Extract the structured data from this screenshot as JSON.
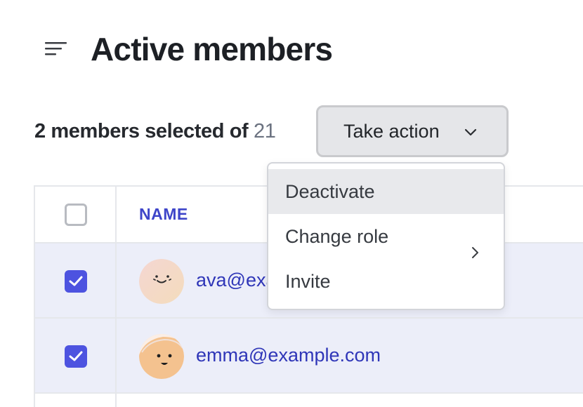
{
  "header": {
    "title": "Active members",
    "menu_icon": "menu-lines-icon"
  },
  "selection": {
    "selected_text": "2 members selected of ",
    "total": "21"
  },
  "action_button": {
    "label": "Take action",
    "icon": "chevron-down-icon"
  },
  "table": {
    "columns": [
      "NAME"
    ],
    "rows": [
      {
        "email": "ava@example.com",
        "selected": true,
        "avatar": "avatar-ava"
      },
      {
        "email": "emma@example.com",
        "selected": true,
        "avatar": "avatar-emma"
      }
    ]
  },
  "dropdown": {
    "items": [
      {
        "label": "Deactivate",
        "highlighted": true
      },
      {
        "label": "Change role",
        "has_submenu": true
      },
      {
        "label": "Invite"
      }
    ]
  },
  "colors": {
    "accent": "#4d53e0",
    "link": "#2f36b8",
    "selected_row": "#eceef9"
  }
}
